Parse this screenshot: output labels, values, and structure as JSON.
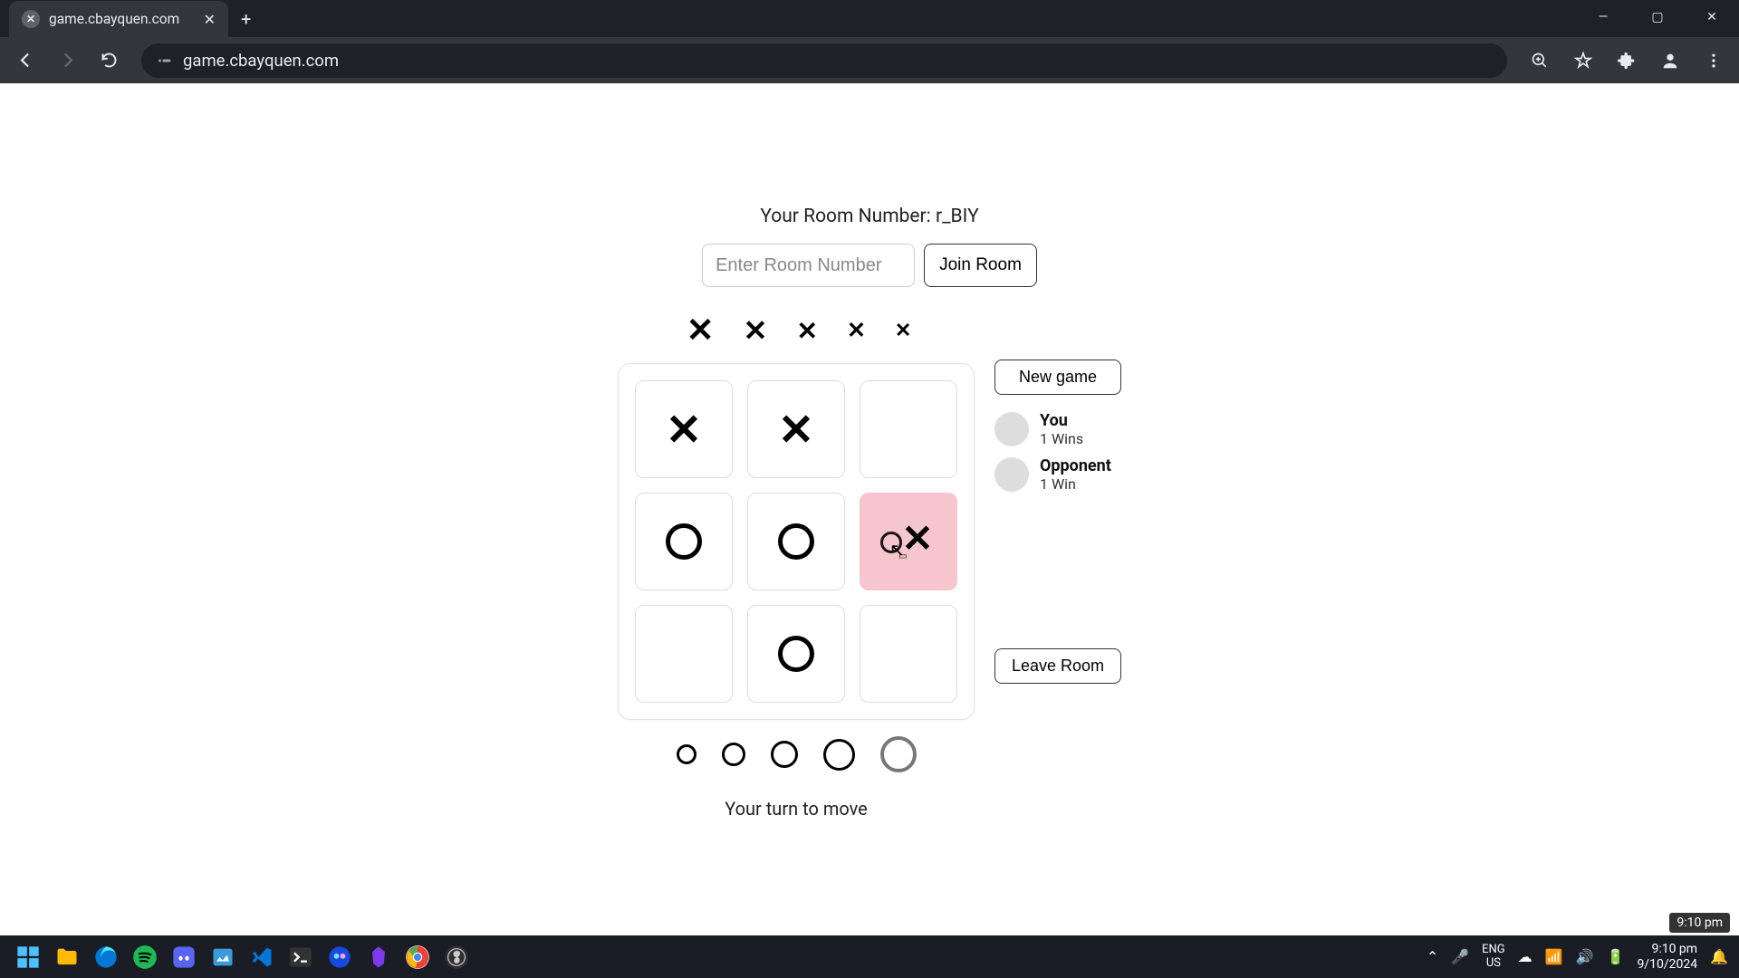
{
  "browser": {
    "tab_title": "game.cbayquen.com",
    "url": "game.cbayquen.com"
  },
  "room": {
    "label_prefix": "Your Room Number: ",
    "number": "r_BIY",
    "input_placeholder": "Enter Room Number",
    "join_label": "Join Room"
  },
  "board": {
    "cells": [
      "X",
      "X",
      "",
      "O",
      "O",
      "X+",
      "",
      "O",
      ""
    ],
    "highlight_index": 5
  },
  "side": {
    "new_game": "New game",
    "leave_room": "Leave Room",
    "players": [
      {
        "name": "You",
        "wins": "1 Wins"
      },
      {
        "name": "Opponent",
        "wins": "1 Win"
      }
    ]
  },
  "turn_text": "Your turn to move",
  "taskbar": {
    "lang1": "ENG",
    "lang2": "US",
    "time": "9:10 pm",
    "date": "9/10/2024",
    "tooltip": "9:10 pm"
  }
}
